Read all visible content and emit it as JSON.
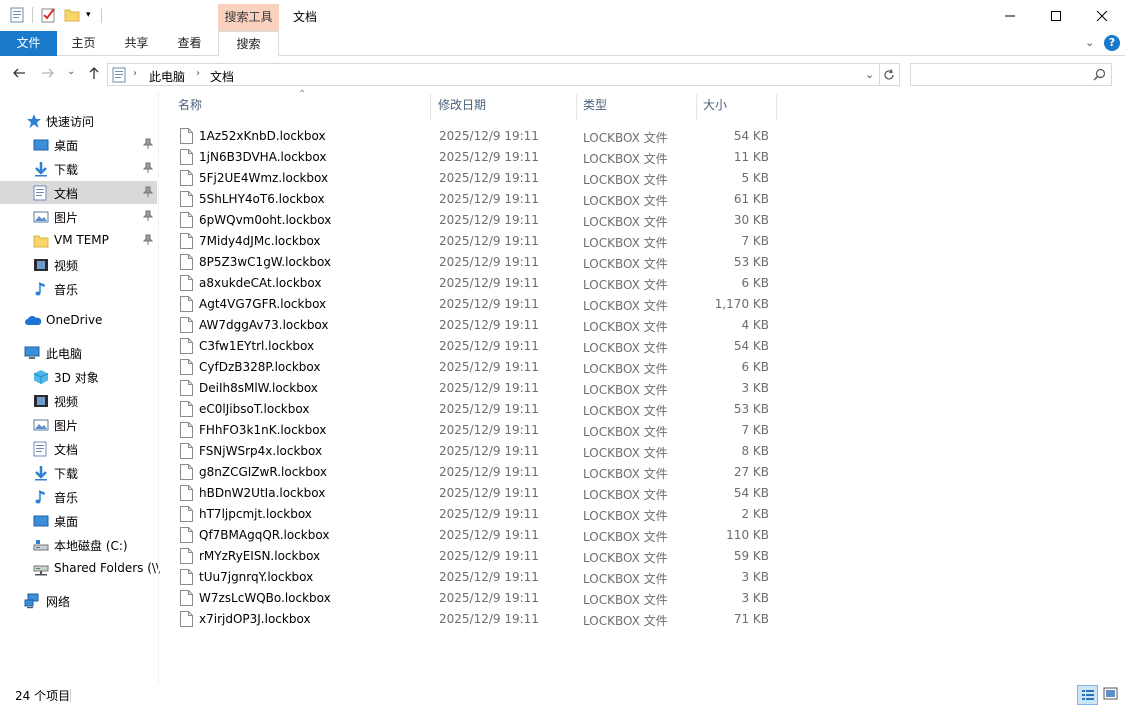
{
  "window": {
    "title": "文档",
    "context_tab_group": "搜索工具"
  },
  "ribbon": {
    "tabs": [
      {
        "label": "文件"
      },
      {
        "label": "主页"
      },
      {
        "label": "共享"
      },
      {
        "label": "查看"
      },
      {
        "label": "搜索"
      }
    ]
  },
  "address": {
    "crumbs": [
      "此电脑",
      "文档"
    ],
    "search_placeholder": ""
  },
  "nav": {
    "items": [
      {
        "label": "快速访问",
        "icon": "star-icon"
      },
      {
        "label": "桌面",
        "icon": "desktop-icon",
        "pinned": true
      },
      {
        "label": "下载",
        "icon": "download-icon",
        "pinned": true
      },
      {
        "label": "文档",
        "icon": "document-icon",
        "pinned": true,
        "selected": true
      },
      {
        "label": "图片",
        "icon": "picture-icon",
        "pinned": true
      },
      {
        "label": "VM TEMP",
        "icon": "folder-icon",
        "pinned": true
      },
      {
        "label": "视频",
        "icon": "video-icon"
      },
      {
        "label": "音乐",
        "icon": "music-icon"
      },
      {
        "label": "OneDrive",
        "icon": "cloud-icon"
      },
      {
        "label": "此电脑",
        "icon": "computer-icon"
      },
      {
        "label": "3D 对象",
        "icon": "cube-icon"
      },
      {
        "label": "视频",
        "icon": "video-icon"
      },
      {
        "label": "图片",
        "icon": "picture-icon"
      },
      {
        "label": "文档",
        "icon": "document-icon"
      },
      {
        "label": "下载",
        "icon": "download-icon"
      },
      {
        "label": "音乐",
        "icon": "music-icon"
      },
      {
        "label": "桌面",
        "icon": "desktop-icon"
      },
      {
        "label": "本地磁盘 (C:)",
        "icon": "drive-icon"
      },
      {
        "label": "Shared Folders (\\\\",
        "icon": "network-drive-icon"
      },
      {
        "label": "网络",
        "icon": "network-icon"
      }
    ]
  },
  "columns": {
    "name": "名称",
    "date": "修改日期",
    "type": "类型",
    "size": "大小"
  },
  "files": [
    {
      "name": "1Az52xKnbD.lockbox",
      "date": "2025/12/9 19:11",
      "type": "LOCKBOX 文件",
      "size": "54 KB"
    },
    {
      "name": "1jN6B3DVHA.lockbox",
      "date": "2025/12/9 19:11",
      "type": "LOCKBOX 文件",
      "size": "11 KB"
    },
    {
      "name": "5Fj2UE4Wmz.lockbox",
      "date": "2025/12/9 19:11",
      "type": "LOCKBOX 文件",
      "size": "5 KB"
    },
    {
      "name": "5ShLHY4oT6.lockbox",
      "date": "2025/12/9 19:11",
      "type": "LOCKBOX 文件",
      "size": "61 KB"
    },
    {
      "name": "6pWQvm0oht.lockbox",
      "date": "2025/12/9 19:11",
      "type": "LOCKBOX 文件",
      "size": "30 KB"
    },
    {
      "name": "7Midy4dJMc.lockbox",
      "date": "2025/12/9 19:11",
      "type": "LOCKBOX 文件",
      "size": "7 KB"
    },
    {
      "name": "8P5Z3wC1gW.lockbox",
      "date": "2025/12/9 19:11",
      "type": "LOCKBOX 文件",
      "size": "53 KB"
    },
    {
      "name": "a8xukdeCAt.lockbox",
      "date": "2025/12/9 19:11",
      "type": "LOCKBOX 文件",
      "size": "6 KB"
    },
    {
      "name": "Agt4VG7GFR.lockbox",
      "date": "2025/12/9 19:11",
      "type": "LOCKBOX 文件",
      "size": "1,170 KB"
    },
    {
      "name": "AW7dggAv73.lockbox",
      "date": "2025/12/9 19:11",
      "type": "LOCKBOX 文件",
      "size": "4 KB"
    },
    {
      "name": "C3fw1EYtrl.lockbox",
      "date": "2025/12/9 19:11",
      "type": "LOCKBOX 文件",
      "size": "54 KB"
    },
    {
      "name": "CyfDzB328P.lockbox",
      "date": "2025/12/9 19:11",
      "type": "LOCKBOX 文件",
      "size": "6 KB"
    },
    {
      "name": "DeiIh8sMlW.lockbox",
      "date": "2025/12/9 19:11",
      "type": "LOCKBOX 文件",
      "size": "3 KB"
    },
    {
      "name": "eC0lJibsoT.lockbox",
      "date": "2025/12/9 19:11",
      "type": "LOCKBOX 文件",
      "size": "53 KB"
    },
    {
      "name": "FHhFO3k1nK.lockbox",
      "date": "2025/12/9 19:11",
      "type": "LOCKBOX 文件",
      "size": "7 KB"
    },
    {
      "name": "FSNjWSrp4x.lockbox",
      "date": "2025/12/9 19:11",
      "type": "LOCKBOX 文件",
      "size": "8 KB"
    },
    {
      "name": "g8nZCGIZwR.lockbox",
      "date": "2025/12/9 19:11",
      "type": "LOCKBOX 文件",
      "size": "27 KB"
    },
    {
      "name": "hBDnW2UtIa.lockbox",
      "date": "2025/12/9 19:11",
      "type": "LOCKBOX 文件",
      "size": "54 KB"
    },
    {
      "name": "hT7ljpcmjt.lockbox",
      "date": "2025/12/9 19:11",
      "type": "LOCKBOX 文件",
      "size": "2 KB"
    },
    {
      "name": "Qf7BMAgqQR.lockbox",
      "date": "2025/12/9 19:11",
      "type": "LOCKBOX 文件",
      "size": "110 KB"
    },
    {
      "name": "rMYzRyEISN.lockbox",
      "date": "2025/12/9 19:11",
      "type": "LOCKBOX 文件",
      "size": "59 KB"
    },
    {
      "name": "tUu7jgnrqY.lockbox",
      "date": "2025/12/9 19:11",
      "type": "LOCKBOX 文件",
      "size": "3 KB"
    },
    {
      "name": "W7zsLcWQBo.lockbox",
      "date": "2025/12/9 19:11",
      "type": "LOCKBOX 文件",
      "size": "3 KB"
    },
    {
      "name": "x7irjdOP3J.lockbox",
      "date": "2025/12/9 19:11",
      "type": "LOCKBOX 文件",
      "size": "71 KB"
    }
  ],
  "status": {
    "item_count": "24 个项目"
  },
  "colors": {
    "accent": "#1979ca",
    "context_tab": "#f8d1bf",
    "selected_nav": "#d9d9d9"
  }
}
